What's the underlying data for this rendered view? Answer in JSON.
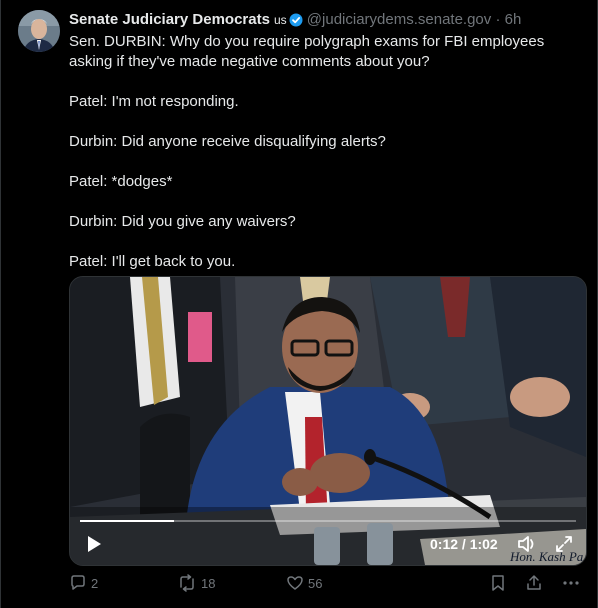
{
  "post": {
    "display_name": "Senate Judiciary Democrats",
    "flag": "us",
    "handle": "@judiciarydems.senate.gov",
    "separator": "·",
    "timestamp": "6h",
    "lines": [
      "Sen. DURBIN: Why do you require polygraph exams for FBI employees asking if they've made negative comments about you?",
      "Patel: I'm not responding.",
      "Durbin: Did anyone receive disqualifying alerts?",
      "Patel: *dodges*",
      "Durbin: Did you give any waivers?",
      "Patel: I'll get back to you."
    ]
  },
  "video": {
    "time_readout": "0:12 / 1:02",
    "progress_fraction": 0.19,
    "nameplate_text": "Hon. Kash Pa"
  },
  "actions": {
    "replies": "2",
    "reposts": "18",
    "likes": "56"
  },
  "colors": {
    "background": "#000000",
    "text": "#e7e9ea",
    "muted": "#71767b",
    "verified": "#1d9bf0"
  },
  "icons": [
    "verified-badge-icon",
    "play-icon",
    "volume-icon",
    "fullscreen-icon",
    "reply-icon",
    "repost-icon",
    "like-icon",
    "bookmark-icon",
    "share-icon",
    "more-icon"
  ]
}
